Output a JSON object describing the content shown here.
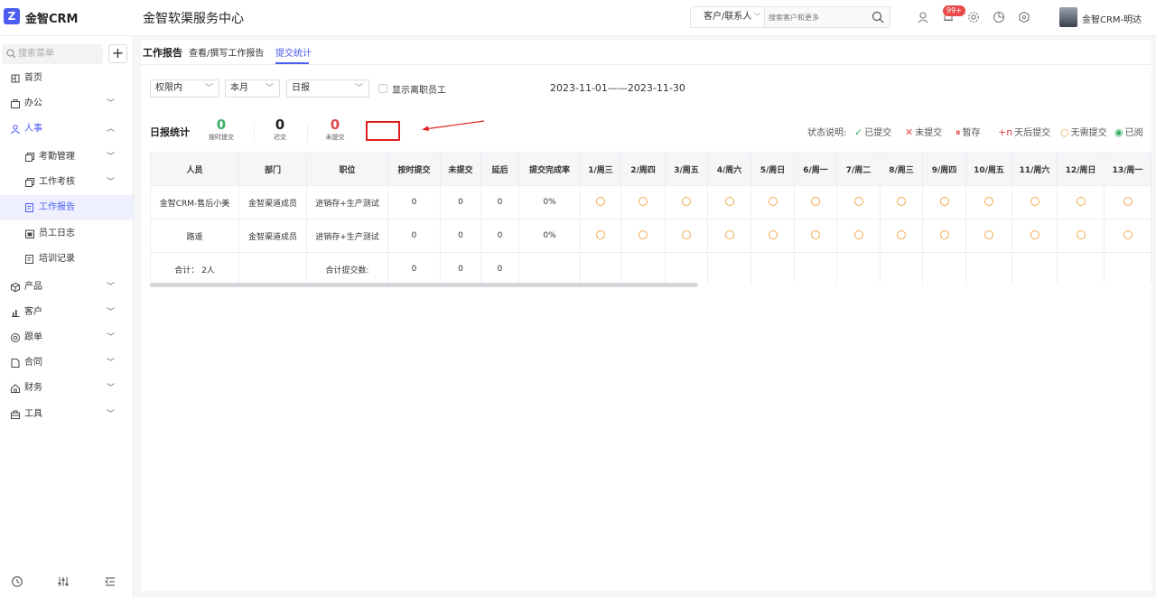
{
  "header": {
    "brand": "金智CRM",
    "center_title": "金智软渠服务中心",
    "search_type": "客户/联系人",
    "search_placeholder": "搜索客户和更多",
    "badge": "99+",
    "user_name": "金智CRM-明达"
  },
  "sidebar": {
    "search_placeholder": "搜索菜单",
    "add_label": "+",
    "items": [
      {
        "label": "首页",
        "icon": "dashboard-icon"
      },
      {
        "label": "办公",
        "icon": "briefcase-icon"
      },
      {
        "label": "人事",
        "icon": "people-icon"
      },
      {
        "label": "产品",
        "icon": "box-icon"
      },
      {
        "label": "客户",
        "icon": "chart-icon"
      },
      {
        "label": "跟单",
        "icon": "target-icon"
      },
      {
        "label": "合同",
        "icon": "document-icon"
      },
      {
        "label": "财务",
        "icon": "home-icon"
      },
      {
        "label": "工具",
        "icon": "toolbox-icon"
      }
    ],
    "sub_items": [
      {
        "label": "考勤管理"
      },
      {
        "label": "工作考核"
      },
      {
        "label": "工作报告"
      },
      {
        "label": "员工日志"
      },
      {
        "label": "培训记录"
      }
    ]
  },
  "tabs": {
    "title": "工作报告",
    "items": [
      "查看/撰写工作报告",
      "提交统计"
    ]
  },
  "filters": {
    "scope": "权限内",
    "period": "本月",
    "type": "日报",
    "show_resigned": "显示离职员工",
    "date_range": "2023-11-01——2023-11-30"
  },
  "stats": {
    "title": "日报统计",
    "items": [
      {
        "num": "0",
        "label": "按时提交",
        "color": "#3fb06a"
      },
      {
        "num": "0",
        "label": "迟交",
        "color": "#222222"
      },
      {
        "num": "0",
        "label": "未提交",
        "color": "#e04848"
      }
    ]
  },
  "legend": {
    "title": "状态说明:",
    "items": [
      {
        "glyph": "✓",
        "label": "已提交",
        "color": "#3fb06a"
      },
      {
        "glyph": "✕",
        "label": "未提交",
        "color": "#e04848"
      },
      {
        "glyph": "⏸",
        "label": "暂存",
        "color": "#e04848"
      },
      {
        "glyph": "+n",
        "label": "天后提交",
        "color": "#e04848"
      },
      {
        "glyph": "○",
        "label": "无需提交",
        "color": "#f0a94a"
      },
      {
        "glyph": "◉",
        "label": "已阅",
        "color": "#3fb06a"
      }
    ]
  },
  "table": {
    "headers": [
      "人员",
      "部门",
      "职位",
      "按时提交",
      "未提交",
      "延后",
      "提交完成率",
      "1/周三",
      "2/周四",
      "3/周五",
      "4/周六",
      "5/周日",
      "6/周一",
      "7/周二",
      "8/周三",
      "9/周四",
      "10/周五",
      "11/周六",
      "12/周日",
      "13/周一"
    ],
    "rows": [
      {
        "person": "金智CRM-售后小美",
        "dept": "金智渠道成员",
        "position": "进销存+生产测试",
        "ontime": "0",
        "missing": "0",
        "late": "0",
        "rate": "0%"
      },
      {
        "person": "路遥",
        "dept": "金智渠道成员",
        "position": "进销存+生产测试",
        "ontime": "0",
        "missing": "0",
        "late": "0",
        "rate": "0%"
      }
    ],
    "total": {
      "label": "合计： 2人",
      "sum_label": "合计提交数:",
      "ontime": "0",
      "missing": "0",
      "late": "0"
    }
  }
}
